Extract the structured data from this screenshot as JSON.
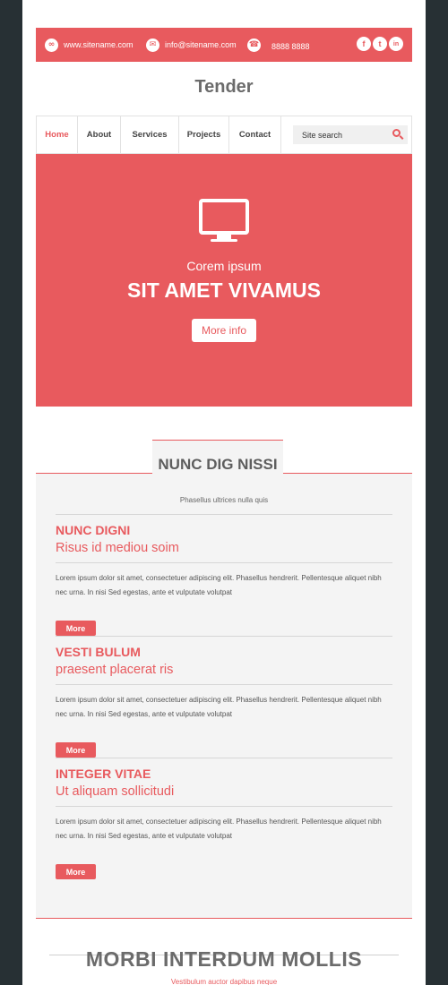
{
  "topbar": {
    "website": "www.sitename.com",
    "email": "info@sitename.com",
    "phone": "8888 8888",
    "social": [
      {
        "icon": "facebook-icon",
        "glyph": "f"
      },
      {
        "icon": "twitter-icon",
        "glyph": "t"
      },
      {
        "icon": "linkedin-icon",
        "glyph": "in"
      }
    ]
  },
  "logo": "Tender",
  "nav": {
    "items": [
      "Home",
      "About",
      "Services",
      "Projects",
      "Contact"
    ],
    "active": "Home",
    "search_placeholder": "Site search"
  },
  "hero": {
    "subtitle": "Corem ipsum",
    "title": "SIT AMET VIVAMUS",
    "button": "More info",
    "icon": "monitor-icon"
  },
  "section": {
    "title": "NUNC DIG NISSI",
    "subtitle": "Phasellus ultrices nulla quis",
    "items": [
      {
        "title": "NUNC DIGNI",
        "subtitle": "Risus id mediou soim",
        "body": "Lorem ipsum dolor sit amet, consectetuer adipiscing elit. Phasellus hendrerit. Pellentesque aliquet nibh nec urna. In nisi Sed egestas, ante et vulputate volutpat",
        "button": "More"
      },
      {
        "title": "VESTI BULUM",
        "subtitle": "praesent placerat ris",
        "body": "Lorem ipsum dolor sit amet, consectetuer adipiscing elit. Phasellus hendrerit. Pellentesque aliquet nibh nec urna. In nisi Sed egestas, ante et vulputate volutpat",
        "button": "More"
      },
      {
        "title": "INTEGER VITAE",
        "subtitle": "Ut aliquam sollicitudi",
        "body": "Lorem ipsum dolor sit amet, consectetuer adipiscing elit. Phasellus hendrerit. Pellentesque aliquet nibh nec urna. In nisi Sed egestas, ante et vulputate volutpat",
        "button": "More"
      }
    ]
  },
  "bottom": {
    "title": "MORBI INTERDUM MOLLIS",
    "subtitle": "Vestibulum auctor dapibus neque"
  },
  "colors": {
    "accent": "#e85a5e",
    "background": "#273034",
    "panel": "#f4f4f4"
  }
}
